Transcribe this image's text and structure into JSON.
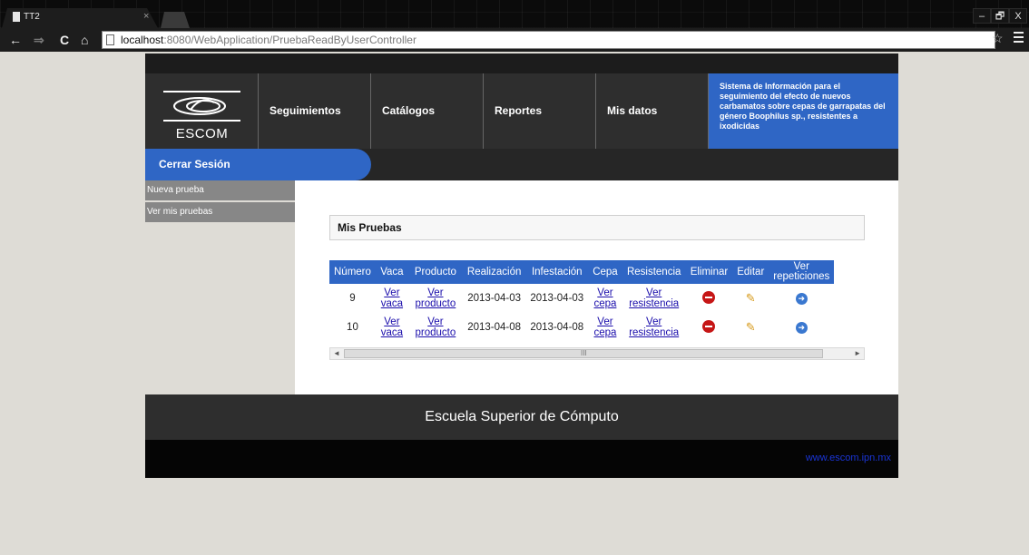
{
  "browser": {
    "tab_title": "TT2",
    "tab_close": "×",
    "url_host": "localhost",
    "url_rest": ":8080/WebApplication/PruebaReadByUserController",
    "back": "←",
    "forward": "⇒",
    "reload": "C",
    "home": "⌂",
    "star": "☆",
    "win_min": "–",
    "win_max": "🗗",
    "win_close": "X"
  },
  "header": {
    "logo_text": "ESCOM",
    "nav": [
      "Seguimientos",
      "Catálogos",
      "Reportes",
      "Mis datos"
    ],
    "info_text": "Sistema de Información para el seguimiento del efecto de nuevos carbamatos sobre cepas de garrapatas del género Boophilus sp., resistentes a ixodicidas"
  },
  "session": {
    "logout_label": "Cerrar Sesión"
  },
  "sidebar": {
    "items": [
      "Nueva prueba",
      "Ver mis pruebas"
    ]
  },
  "main": {
    "panel_title": "Mis Pruebas",
    "columns": [
      "Número",
      "Vaca",
      "Producto",
      "Realización",
      "Infestación",
      "Cepa",
      "Resistencia",
      "Eliminar",
      "Editar",
      "Ver repeticiones"
    ],
    "rows": [
      {
        "numero": "9",
        "vaca": "Ver vaca",
        "producto": "Ver producto",
        "realizacion": "2013-04-03",
        "infestacion": "2013-04-03",
        "cepa": "Ver cepa",
        "resistencia": "Ver resistencia"
      },
      {
        "numero": "10",
        "vaca": "Ver vaca",
        "producto": "Ver producto",
        "realizacion": "2013-04-08",
        "infestacion": "2013-04-08",
        "cepa": "Ver cepa",
        "resistencia": "Ver resistencia"
      }
    ],
    "scroll_grip": "III",
    "scroll_left": "◄",
    "scroll_right": "►"
  },
  "footer": {
    "school_name": "Escuela Superior de Cómputo",
    "link": "www.escom.ipn.mx"
  },
  "colors": {
    "accent_blue": "#2f66c5",
    "dark": "#2e2e2e"
  }
}
